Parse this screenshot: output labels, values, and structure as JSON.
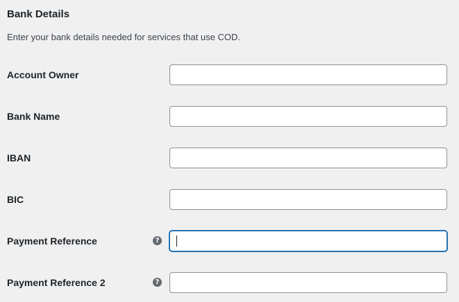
{
  "section": {
    "title": "Bank Details",
    "description": "Enter your bank details needed for services that use COD."
  },
  "fields": [
    {
      "label": "Account Owner",
      "value": "",
      "has_help": false,
      "focused": false
    },
    {
      "label": "Bank Name",
      "value": "",
      "has_help": false,
      "focused": false
    },
    {
      "label": "IBAN",
      "value": "",
      "has_help": false,
      "focused": false
    },
    {
      "label": "BIC",
      "value": "",
      "has_help": false,
      "focused": false
    },
    {
      "label": "Payment Reference",
      "value": "",
      "has_help": true,
      "help_icon": "question-circle-icon",
      "focused": true
    },
    {
      "label": "Payment Reference 2",
      "value": "",
      "has_help": true,
      "help_icon": "question-circle-icon",
      "focused": false
    }
  ],
  "colors": {
    "background": "#f0f0f1",
    "focus_border": "#2271b1",
    "input_border": "#8c8f94",
    "help_icon": "#646970"
  }
}
